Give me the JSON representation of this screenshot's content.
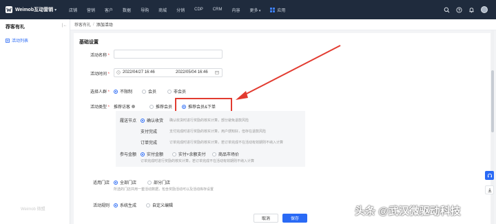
{
  "brand": {
    "name": "Weimob互动营销",
    "caret": "▾"
  },
  "nav": {
    "items": [
      "店铺",
      "营销",
      "客户",
      "数据",
      "导购",
      "商城",
      "分销",
      "CDP",
      "CRM",
      "内容"
    ],
    "more": "更多",
    "app": "应用"
  },
  "sidebar": {
    "title": "荐客有礼",
    "collapse": "|←",
    "active_item": "活动列表",
    "watermark": "Weimob 微盟"
  },
  "breadcrumb": {
    "parent": "荐客有礼",
    "sep": "/",
    "current": "添加活动"
  },
  "form": {
    "section_title": "基础设置",
    "name": {
      "label": "活动名称",
      "value": ""
    },
    "time": {
      "label": "活动时间",
      "start": "2022/04/27 16:46",
      "end": "2022/05/04 16:46"
    },
    "audience": {
      "label": "选择人群",
      "options": [
        "不限制",
        "会员",
        "非会员"
      ],
      "selected": 0
    },
    "type": {
      "label": "活动类型",
      "options": [
        "推荐访客",
        "推荐会员",
        "推荐会员&下单"
      ],
      "selected": 2
    },
    "settle": {
      "label": "履送节点",
      "options": [
        {
          "label": "确认收货",
          "desc": "确认收货时进行奖励的核实计算，部分避免退款风险"
        },
        {
          "label": "支付完成",
          "desc": "支付完成时进行奖励的核实计算，用户感知好，但存在退款风险"
        },
        {
          "label": "订单完成",
          "desc": "订单完成时进行奖励的核实计算，若订单完成不在活动有效期则不纳入计算"
        }
      ],
      "selected": 0
    },
    "amount": {
      "label": "参与金额",
      "options": [
        "实付金额",
        "实付+余额支付",
        "商品市场价"
      ],
      "selected": 0,
      "desc": "订单完成时进行奖励的核实计算，若订单完成不在活动有效期则不纳入计算"
    },
    "store": {
      "label": "适用门店",
      "options": [
        "全部门店",
        "部分门店"
      ],
      "selected": 0,
      "desc": "所选的门店共用一套活动数据，包含奖励活动可以及活动库存设置"
    },
    "rule": {
      "label": "活动规则",
      "options": [
        "系统生成",
        "自定义编辑"
      ],
      "selected": 0
    }
  },
  "buttons": {
    "cancel": "取消",
    "save": "保存"
  },
  "watermark": "头条 @武汉微驱动科技",
  "colors": {
    "accent": "#2a6af5",
    "highlight": "#e23b30",
    "nav_bg": "#1f2b3d"
  }
}
